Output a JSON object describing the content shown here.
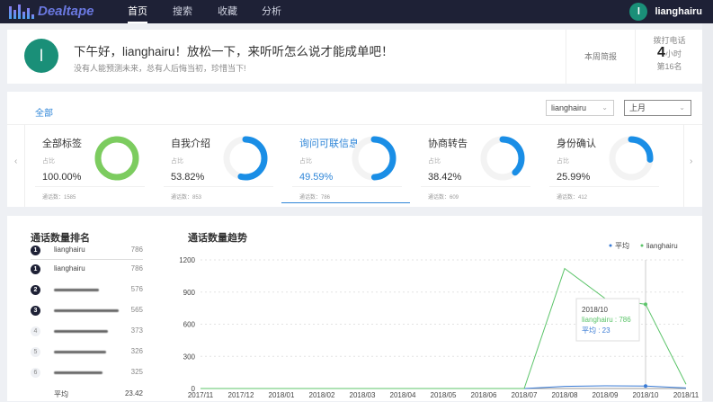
{
  "nav": {
    "brand": "Dealtape",
    "tabs": [
      "首页",
      "搜索",
      "收藏",
      "分析"
    ],
    "user": "lianghairu",
    "avatar_letter": "l"
  },
  "greeting": {
    "avatar_letter": "l",
    "title": "下午好，lianghairu！放松一下，来听听怎么说才能成单吧！",
    "subtitle": "没有人能预测未来，总有人后悔当初，珍惜当下!",
    "weekly": "本周简报",
    "calls_label": "拨打电话",
    "calls_value": "4",
    "calls_unit": "小时",
    "rank": "第16名"
  },
  "filters": {
    "all": "全部",
    "user": "lianghairu",
    "period": "上月"
  },
  "stats": [
    {
      "title": "全部标签",
      "ratio_label": "占比",
      "percent": "100.00%",
      "fraction": 1.0,
      "count": "通话数：1585",
      "color": "#7ccc5f"
    },
    {
      "title": "自我介绍",
      "ratio_label": "占比",
      "percent": "53.82%",
      "fraction": 0.5382,
      "count": "通话数：853",
      "color": "#1a8ee6"
    },
    {
      "title": "询问可联信息",
      "ratio_label": "占比",
      "percent": "49.59%",
      "fraction": 0.4959,
      "count": "通话数：786",
      "color": "#1a8ee6"
    },
    {
      "title": "协商转告",
      "ratio_label": "占比",
      "percent": "38.42%",
      "fraction": 0.3842,
      "count": "通话数：609",
      "color": "#1a8ee6"
    },
    {
      "title": "身份确认",
      "ratio_label": "占比",
      "percent": "25.99%",
      "fraction": 0.2599,
      "count": "通话数：412",
      "color": "#1a8ee6"
    }
  ],
  "ranking": {
    "title": "通话数量排名",
    "me": {
      "rank": "1",
      "name": "lianghairu",
      "value": "786"
    },
    "rows": [
      {
        "rank": "1",
        "name": "lianghairu",
        "value": "786"
      },
      {
        "rank": "2",
        "name": "",
        "value": "576"
      },
      {
        "rank": "3",
        "name": "",
        "value": "565"
      },
      {
        "rank": "4",
        "name": "",
        "value": "373"
      },
      {
        "rank": "5",
        "name": "",
        "value": "326"
      },
      {
        "rank": "6",
        "name": "",
        "value": "325"
      }
    ],
    "avg_label": "平均",
    "avg_value": "23.42"
  },
  "chart_data": {
    "type": "line",
    "title": "通话数量趋势",
    "x": [
      "2017/11",
      "2017/12",
      "2018/01",
      "2018/02",
      "2018/03",
      "2018/04",
      "2018/05",
      "2018/06",
      "2018/07",
      "2018/08",
      "2018/09",
      "2018/10",
      "2018/11"
    ],
    "series": [
      {
        "name": "平均",
        "color": "#3a7bd5",
        "values": [
          0,
          0,
          0,
          0,
          0,
          0,
          0,
          0,
          0,
          20,
          25,
          23,
          5
        ]
      },
      {
        "name": "lianghairu",
        "color": "#5cc46a",
        "values": [
          0,
          0,
          0,
          0,
          0,
          0,
          0,
          0,
          0,
          1120,
          840,
          786,
          40
        ]
      }
    ],
    "yticks": [
      0,
      300,
      600,
      900,
      1200
    ],
    "ylim": [
      0,
      1200
    ],
    "legend": "top-right",
    "tooltip": {
      "title": "2018/10",
      "line1": "lianghairu : 786",
      "line2": "平均 : 23"
    }
  }
}
